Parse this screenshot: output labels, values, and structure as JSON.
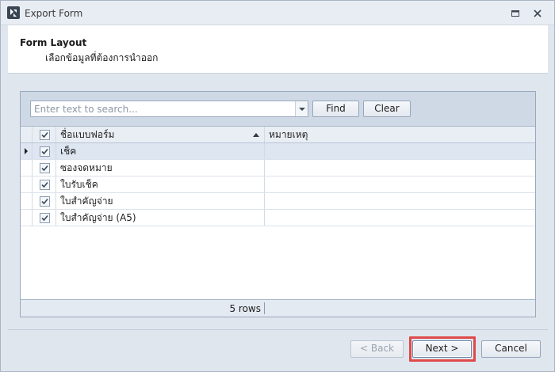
{
  "window": {
    "title": "Export Form",
    "icon": "app-logo-icon",
    "controls": [
      "restore-icon",
      "close-icon"
    ]
  },
  "header": {
    "title": "Form Layout",
    "subtitle": "เลือกข้อมูลที่ต้องการนำออก"
  },
  "search": {
    "placeholder": "Enter text to search...",
    "value": "",
    "find_label": "Find",
    "clear_label": "Clear"
  },
  "table": {
    "columns": [
      "ชื่อแบบฟอร์ม",
      "หมายเหตุ"
    ],
    "sort_column": "ชื่อแบบฟอร์ม",
    "sort_direction": "ascending",
    "header_checked": true,
    "rows": [
      {
        "name": "เช็ค",
        "note": "",
        "checked": true,
        "selected": true
      },
      {
        "name": "ซองจดหมาย",
        "note": "",
        "checked": true,
        "selected": false
      },
      {
        "name": "ใบรับเช็ค",
        "note": "",
        "checked": true,
        "selected": false
      },
      {
        "name": "ใบสำคัญจ่าย",
        "note": "",
        "checked": true,
        "selected": false
      },
      {
        "name": "ใบสำคัญจ่าย (A5)",
        "note": "",
        "checked": true,
        "selected": false
      }
    ],
    "row_count_text": "5 rows"
  },
  "buttons": {
    "back_label": "< Back",
    "back_enabled": false,
    "next_label": "Next >",
    "cancel_label": "Cancel"
  },
  "colors": {
    "highlight": "#e04a4a",
    "selected_row": "#dde6f1"
  }
}
